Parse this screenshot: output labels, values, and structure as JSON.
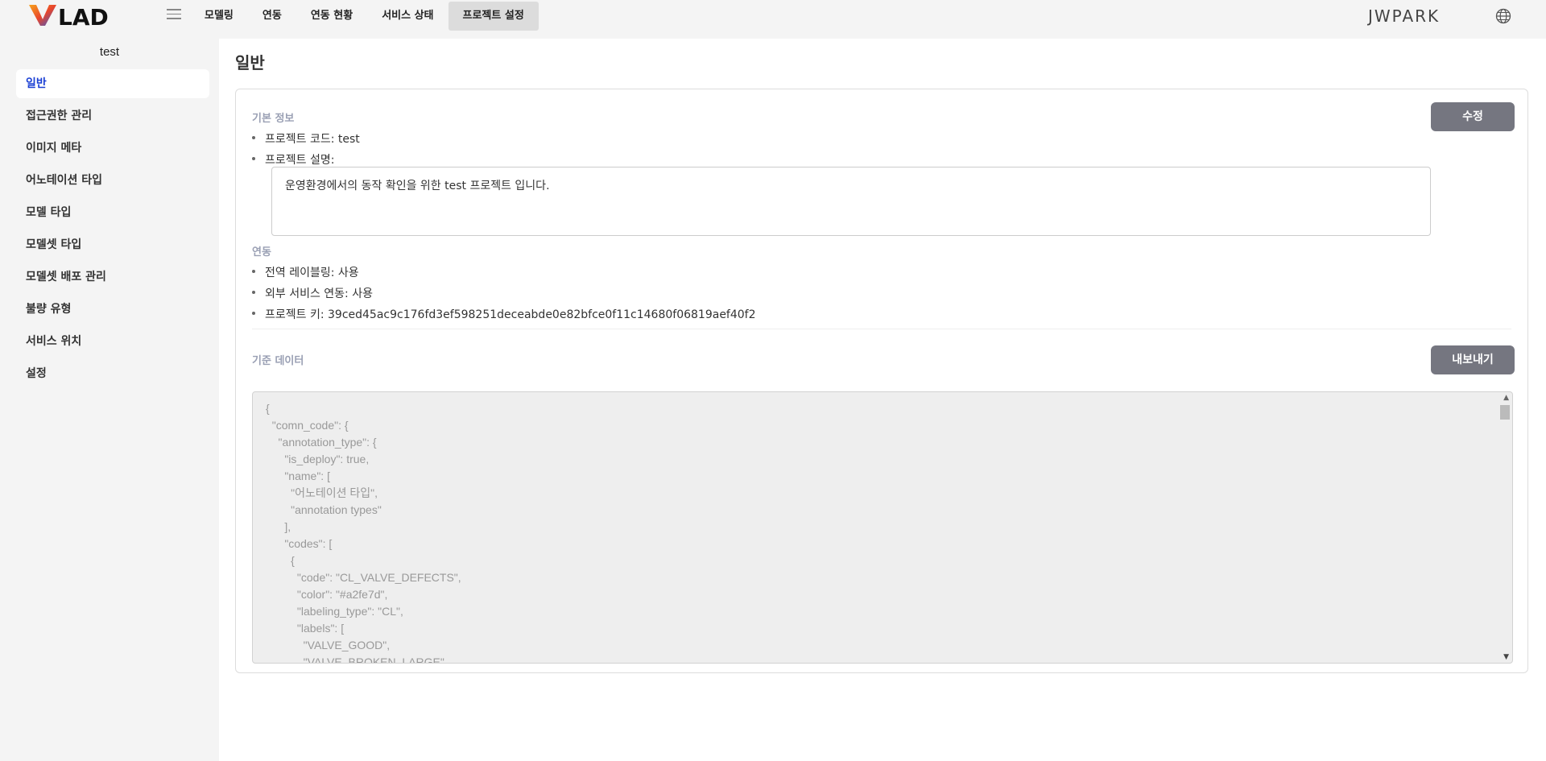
{
  "header": {
    "logo_text": "VLAD",
    "nav": [
      "모델링",
      "연동",
      "연동 현황",
      "서비스 상태",
      "프로젝트 설정"
    ],
    "active_nav": "프로젝트 설정",
    "user": "JWPARK",
    "icons": [
      "menu-icon",
      "globe-icon"
    ]
  },
  "sidebar": {
    "project": "test",
    "items": [
      "일반",
      "접근권한 관리",
      "이미지 메타",
      "어노테이션 타입",
      "모델 타입",
      "모델셋 타입",
      "모델셋 배포 관리",
      "불량 유형",
      "서비스 위치",
      "설정"
    ],
    "active": "일반"
  },
  "main": {
    "title": "일반",
    "basic": {
      "label": "기본 정보",
      "edit_button": "수정",
      "code": "프로젝트 코드: test",
      "desc_label": "프로젝트 설명:",
      "desc": "운영환경에서의 동작 확인을 위한 test 프로젝트 입니다."
    },
    "integration": {
      "label": "연동",
      "items": [
        "전역 레이블링: 사용",
        "외부 서비스 연동: 사용",
        "프로젝트 키: 39ced45ac9c176fd3ef598251deceabde0e82bfce0f11c14680f06819aef40f2"
      ]
    },
    "reference": {
      "label": "기준 데이터",
      "export_button": "내보내기",
      "json": "{\n  \"comn_code\": {\n    \"annotation_type\": {\n      \"is_deploy\": true,\n      \"name\": [\n        \"어노테이션 타입\",\n        \"annotation types\"\n      ],\n      \"codes\": [\n        {\n          \"code\": \"CL_VALVE_DEFECTS\",\n          \"color\": \"#a2fe7d\",\n          \"labeling_type\": \"CL\",\n          \"labels\": [\n            \"VALVE_GOOD\",\n            \"VALVE_BROKEN_LARGE\","
    }
  },
  "colors": {
    "accent": "#1a3fd4",
    "button": "#757680",
    "section_label": "#9aa0b4"
  }
}
